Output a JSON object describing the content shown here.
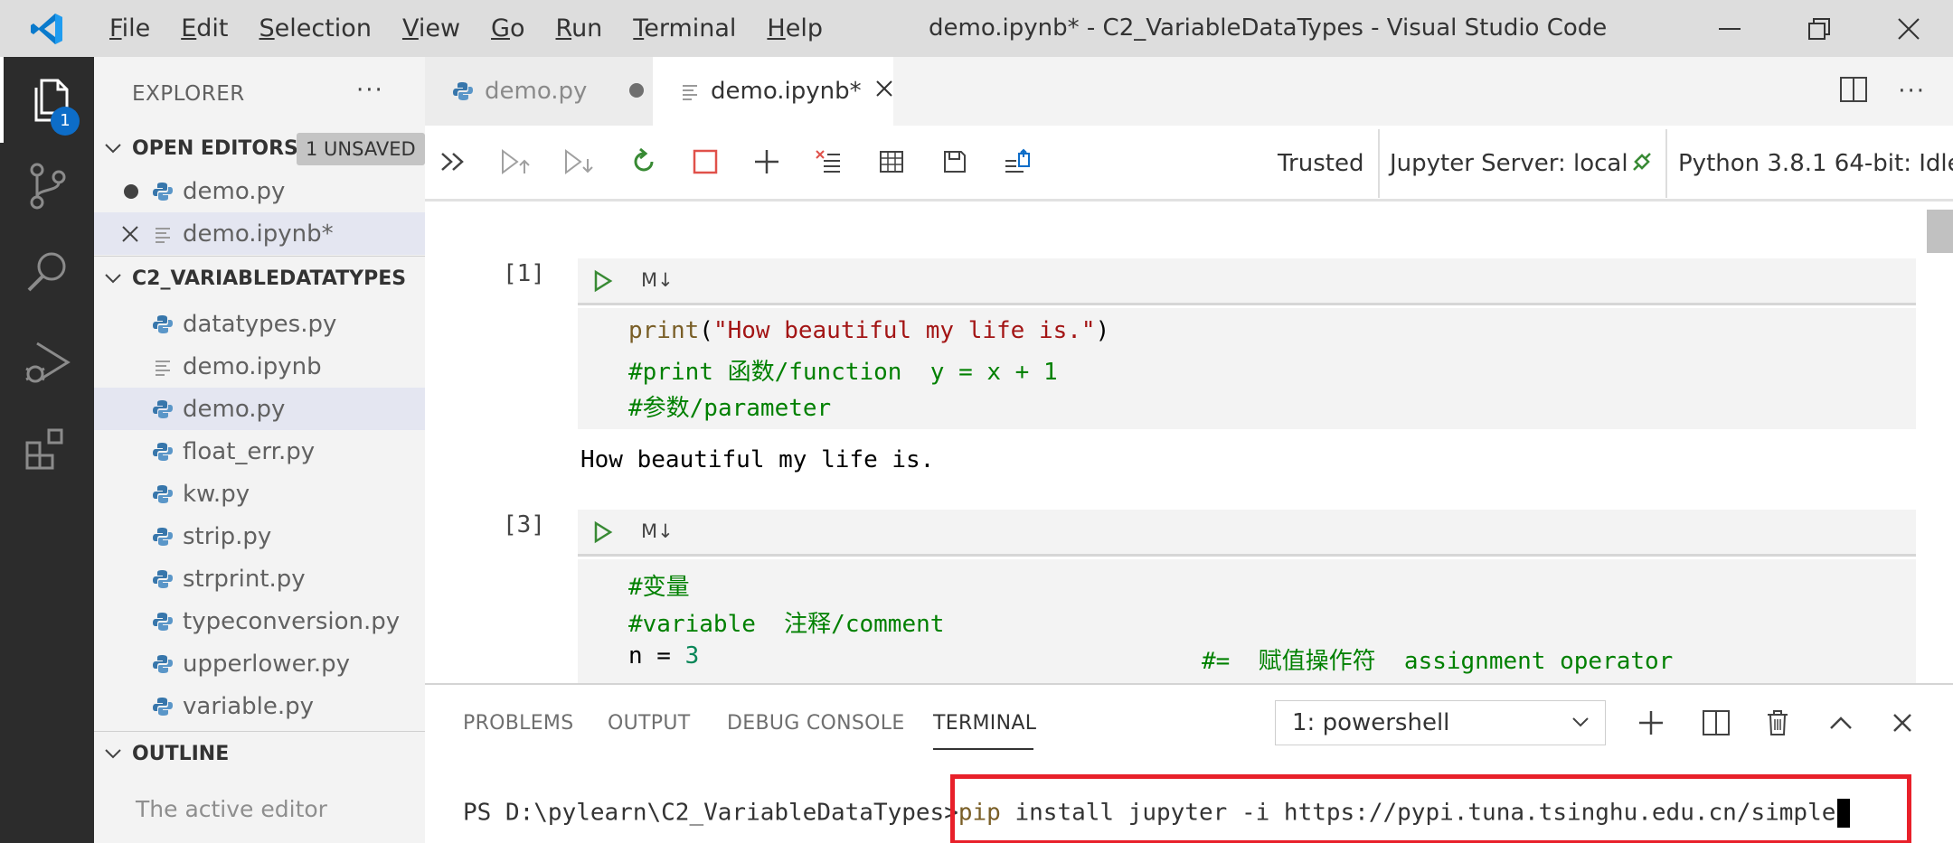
{
  "titlebar": {
    "title": "demo.ipynb* - C2_VariableDataTypes - Visual Studio Code",
    "menu": [
      {
        "u": "F",
        "rest": "ile"
      },
      {
        "u": "E",
        "rest": "dit"
      },
      {
        "u": "S",
        "rest": "election"
      },
      {
        "u": "V",
        "rest": "iew"
      },
      {
        "u": "G",
        "rest": "o"
      },
      {
        "u": "R",
        "rest": "un"
      },
      {
        "u": "T",
        "rest": "erminal"
      },
      {
        "u": "H",
        "rest": "elp"
      }
    ]
  },
  "activitybar": {
    "explorer_badge": "1"
  },
  "sidebar": {
    "title": "EXPLORER",
    "more": "···",
    "open_editors": {
      "label": "OPEN EDITORS",
      "badge": "1 UNSAVED",
      "items": [
        "demo.py",
        "demo.ipynb*"
      ]
    },
    "folder": {
      "label": "C2_VARIABLEDATATYPES",
      "files": [
        "datatypes.py",
        "demo.ipynb",
        "demo.py",
        "float_err.py",
        "kw.py",
        "strip.py",
        "strprint.py",
        "typeconversion.py",
        "upperlower.py",
        "variable.py"
      ]
    },
    "outline": {
      "label": "OUTLINE",
      "message": "The active editor"
    }
  },
  "tabs": [
    {
      "label": "demo.py"
    },
    {
      "label": "demo.ipynb*"
    }
  ],
  "toolbar": {
    "trusted": "Trusted",
    "server": "Jupyter Server: local",
    "kernel": "Python 3.8.1 64-bit: Idle"
  },
  "cells": [
    {
      "count": "[1]",
      "md": "M↓",
      "output": "How beautiful my life is."
    },
    {
      "count": "[3]",
      "md": "M↓"
    }
  ],
  "code": {
    "c1_l1_fn": "print",
    "c1_l1_p1": "(",
    "c1_l1_str": "\"How beautiful my life is.\"",
    "c1_l1_p2": ")",
    "c1_l2": "#print 函数/function  y = x + 1",
    "c1_l3": "#参数/parameter",
    "c2_l1": "#变量",
    "c2_l2": "#variable  注释/comment",
    "c2_l3_a": "n = ",
    "c2_l3_num": "3",
    "c2_l3_cmt": "#=  赋值操作符  assignment operator"
  },
  "panel": {
    "tabs": [
      "PROBLEMS",
      "OUTPUT",
      "DEBUG CONSOLE",
      "TERMINAL"
    ],
    "terminal_select": "1: powershell",
    "prompt": "PS D:\\pylearn\\C2_VariableDataTypes>",
    "cmd_pip": "pip",
    "cmd_rest": " install jupyter -i https://pypi.tuna.tsinghu.edu.cn/simple"
  },
  "colors": {
    "accent": "#0d6dc8",
    "highlight": "#e8202a",
    "run_green": "#388a34"
  }
}
